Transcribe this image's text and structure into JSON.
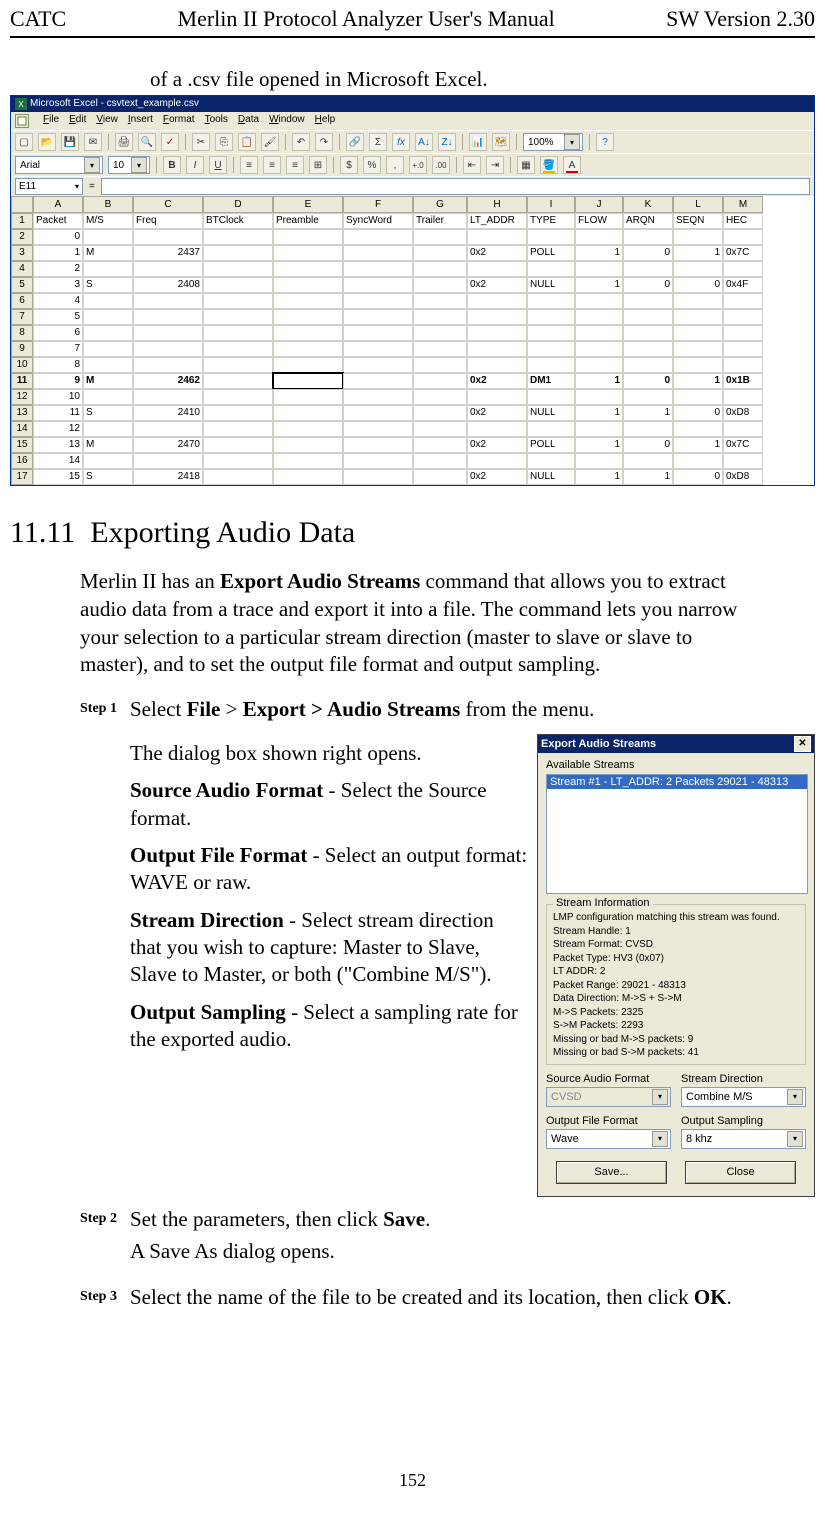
{
  "header": {
    "left": "CATC",
    "center": "Merlin II Protocol Analyzer User's Manual",
    "right": "SW Version 2.30"
  },
  "intro_line": "of a .csv file opened in Microsoft Excel.",
  "excel": {
    "title": "Microsoft Excel - csvtext_example.csv",
    "menu": [
      "File",
      "Edit",
      "View",
      "Insert",
      "Format",
      "Tools",
      "Data",
      "Window",
      "Help"
    ],
    "toolbar2": {
      "font": "Arial",
      "size": "10",
      "bold": "B",
      "italic": "I",
      "underline": "U",
      "currency": "$",
      "percent": "%",
      "comma": ",",
      "dec_inc": ".0",
      "dec_dec": ".00"
    },
    "zoom": "100%",
    "name_box": "E11",
    "formula": "=",
    "col_letters": [
      "A",
      "B",
      "C",
      "D",
      "E",
      "F",
      "G",
      "H",
      "I",
      "J",
      "K",
      "L",
      "M"
    ],
    "headers": [
      "Packet",
      "M/S",
      "Freq",
      "BTClock",
      "Preamble",
      "SyncWord",
      "Trailer",
      "LT_ADDR",
      "TYPE",
      "FLOW",
      "ARQN",
      "SEQN",
      "HEC"
    ],
    "rows": [
      {
        "n": 2,
        "bold": false,
        "cells": [
          "0",
          "",
          "",
          "",
          "",
          "",
          "",
          "",
          "",
          "",
          "",
          "",
          ""
        ]
      },
      {
        "n": 3,
        "bold": false,
        "cells": [
          "1",
          "M",
          "2437",
          "",
          "",
          "",
          "",
          "0x2",
          "POLL",
          "1",
          "0",
          "1",
          "0x7C"
        ]
      },
      {
        "n": 4,
        "bold": false,
        "cells": [
          "2",
          "",
          "",
          "",
          "",
          "",
          "",
          "",
          "",
          "",
          "",
          "",
          ""
        ]
      },
      {
        "n": 5,
        "bold": false,
        "cells": [
          "3",
          "S",
          "2408",
          "",
          "",
          "",
          "",
          "0x2",
          "NULL",
          "1",
          "0",
          "0",
          "0x4F"
        ]
      },
      {
        "n": 6,
        "bold": false,
        "cells": [
          "4",
          "",
          "",
          "",
          "",
          "",
          "",
          "",
          "",
          "",
          "",
          "",
          ""
        ]
      },
      {
        "n": 7,
        "bold": false,
        "cells": [
          "5",
          "",
          "",
          "",
          "",
          "",
          "",
          "",
          "",
          "",
          "",
          "",
          ""
        ]
      },
      {
        "n": 8,
        "bold": false,
        "cells": [
          "6",
          "",
          "",
          "",
          "",
          "",
          "",
          "",
          "",
          "",
          "",
          "",
          ""
        ]
      },
      {
        "n": 9,
        "bold": false,
        "cells": [
          "7",
          "",
          "",
          "",
          "",
          "",
          "",
          "",
          "",
          "",
          "",
          "",
          ""
        ]
      },
      {
        "n": 10,
        "bold": false,
        "cells": [
          "8",
          "",
          "",
          "",
          "",
          "",
          "",
          "",
          "",
          "",
          "",
          "",
          ""
        ]
      },
      {
        "n": 11,
        "bold": true,
        "active_e": true,
        "cells": [
          "9",
          "M",
          "2462",
          "",
          "",
          "",
          "",
          "0x2",
          "DM1",
          "1",
          "0",
          "1",
          "0x1B"
        ]
      },
      {
        "n": 12,
        "bold": false,
        "cells": [
          "10",
          "",
          "",
          "",
          "",
          "",
          "",
          "",
          "",
          "",
          "",
          "",
          ""
        ]
      },
      {
        "n": 13,
        "bold": false,
        "cells": [
          "11",
          "S",
          "2410",
          "",
          "",
          "",
          "",
          "0x2",
          "NULL",
          "1",
          "1",
          "0",
          "0xD8"
        ]
      },
      {
        "n": 14,
        "bold": false,
        "cells": [
          "12",
          "",
          "",
          "",
          "",
          "",
          "",
          "",
          "",
          "",
          "",
          "",
          ""
        ]
      },
      {
        "n": 15,
        "bold": false,
        "cells": [
          "13",
          "M",
          "2470",
          "",
          "",
          "",
          "",
          "0x2",
          "POLL",
          "1",
          "0",
          "1",
          "0x7C"
        ]
      },
      {
        "n": 16,
        "bold": false,
        "cells": [
          "14",
          "",
          "",
          "",
          "",
          "",
          "",
          "",
          "",
          "",
          "",
          "",
          ""
        ]
      },
      {
        "n": 17,
        "bold": false,
        "cells": [
          "15",
          "S",
          "2418",
          "",
          "",
          "",
          "",
          "0x2",
          "NULL",
          "1",
          "1",
          "0",
          "0xD8"
        ]
      }
    ]
  },
  "section": {
    "number": "11.11",
    "title": "Exporting Audio Data"
  },
  "section_para_prefix": "Merlin II has an ",
  "section_para_bold": "Export Audio Streams",
  "section_para_suffix": " command that allows you to extract audio data from a trace and export it into a file.  The command lets you narrow your selection to a particular stream direction (master to slave or slave to master), and to set the output file format and output sampling.",
  "steps": {
    "s1_label": "Step 1",
    "s1_text_a": "Select ",
    "s1_b1": "File",
    "s1_text_b": " > ",
    "s1_b2": "Export > Audio Streams",
    "s1_text_c": " from the menu.",
    "s1_sub1": "The dialog box shown right opens.",
    "s1_sub2_b": "Source Audio Format",
    "s1_sub2_t": " - Select the Source format.",
    "s1_sub3_b": "Output File Format",
    "s1_sub3_t": " - Select an output format:  WAVE or raw.",
    "s1_sub4_b": "Stream Direction",
    "s1_sub4_t": " - Select stream direction that you wish to capture:  Master to Slave,  Slave to Master, or both (\"Combine M/S\").",
    "s1_sub5_b": "Output Sampling",
    "s1_sub5_t": " - Select a sampling rate for the exported audio.",
    "s2_label": "Step 2",
    "s2_a": "Set the parameters, then click ",
    "s2_b": "Save",
    "s2_c": ".",
    "s2_sub": "A Save As dialog opens.",
    "s3_label": "Step 3",
    "s3_a": "Select the name of the file to be created and its location, then click ",
    "s3_b": "OK",
    "s3_c": "."
  },
  "dialog": {
    "title": "Export Audio Streams",
    "avail_label": "Available Streams",
    "stream_item": "Stream #1 - LT_ADDR: 2  Packets 29021 - 48313",
    "group_title": "Stream Information",
    "info": [
      "LMP configuration matching this stream was found.",
      "Stream Handle: 1",
      "Stream Format: CVSD",
      "Packet Type: HV3 (0x07)",
      "LT ADDR: 2",
      "Packet Range: 29021 - 48313",
      "Data Direction: M->S + S->M",
      "M->S Packets: 2325",
      "S->M Packets: 2293",
      "Missing or bad M->S packets: 9",
      "Missing or bad S->M packets: 41"
    ],
    "src_label": "Source Audio Format",
    "src_value": "CVSD",
    "dir_label": "Stream Direction",
    "dir_value": "Combine M/S",
    "out_label": "Output File Format",
    "out_value": "Wave",
    "samp_label": "Output Sampling",
    "samp_value": "8 khz",
    "save_btn": "Save...",
    "close_btn": "Close"
  },
  "page_number": "152"
}
